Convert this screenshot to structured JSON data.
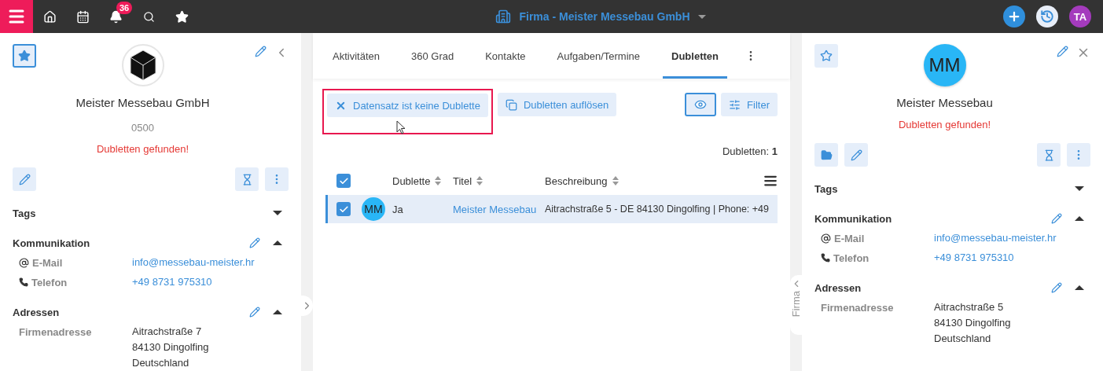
{
  "topbar": {
    "nav": [
      {
        "kind": "home"
      },
      {
        "kind": "calendar"
      },
      {
        "kind": "bell",
        "badge": "36"
      },
      {
        "kind": "search"
      },
      {
        "kind": "star"
      }
    ],
    "title": "Firma - Meister Messebau GmbH",
    "user": "TA"
  },
  "left_panel": {
    "favorite": true,
    "header_action": {
      "kind": "collapse"
    },
    "avatar": {
      "kind": "logo"
    },
    "name": "Meister Messebau GmbH",
    "number": "0500",
    "warning": "Dubletten gefunden!",
    "tools_left": [
      {
        "kind": "edit"
      }
    ],
    "tools_right": [
      {
        "kind": "hourglass"
      },
      {
        "kind": "more"
      }
    ],
    "sections": [
      {
        "title": "Tags",
        "expanded": false,
        "editable": false
      },
      {
        "title": "Kommunikation",
        "expanded": true,
        "editable": true,
        "rows": [
          {
            "kind": "email",
            "label": "E-Mail",
            "lines": [
              "info@messebau-meister.hr"
            ]
          },
          {
            "kind": "phone",
            "label": "Telefon",
            "lines": [
              "+49 8731 975310"
            ]
          }
        ]
      },
      {
        "title": "Adressen",
        "expanded": true,
        "editable": true,
        "rows": [
          {
            "kind": "address",
            "label": "Firmenadresse",
            "lines": [
              "Aitrachstraße 7",
              "84130 Dingolfing",
              "Deutschland"
            ]
          }
        ]
      }
    ]
  },
  "center": {
    "tabs": [
      {
        "label": "Aktivitäten",
        "selected": false
      },
      {
        "label": "360 Grad",
        "selected": false
      },
      {
        "label": "Kontakte",
        "selected": false
      },
      {
        "label": "Aufgaben/Termine",
        "selected": false
      },
      {
        "label": "Dubletten",
        "selected": true
      }
    ],
    "actions": [
      {
        "kind": "dismiss",
        "label": "Datensatz ist keine Dublette",
        "highlighted": true
      },
      {
        "kind": "resolve",
        "label": "Dubletten auflösen",
        "highlighted": false
      }
    ],
    "view_toggle": {
      "selected": true
    },
    "filter": "Filter",
    "count": "Dubletten: **1**",
    "table": {
      "all_checked": true,
      "columns": [
        {
          "label": "Dublette",
          "sortable": true
        },
        {
          "label": "Titel",
          "sortable": true
        },
        {
          "label": "Beschreibung",
          "sortable": true
        }
      ],
      "rows": [
        {
          "checked": true,
          "selected": true,
          "avatar": "MM",
          "dublette": "Ja",
          "titel": "Meister Messebau",
          "beschreibung": "Aitrachstraße 5 - DE 84130 Dingolfing | Phone: +49"
        }
      ]
    }
  },
  "side_tab": "Firma",
  "right_panel": {
    "favorite": false,
    "header_action": {
      "kind": "close"
    },
    "avatar": {
      "kind": "initials",
      "text": "MM"
    },
    "name": "Meister Messebau",
    "warning": "Dubletten gefunden!",
    "tools_left": [
      {
        "kind": "folder"
      },
      {
        "kind": "edit"
      }
    ],
    "tools_right": [
      {
        "kind": "hourglass"
      },
      {
        "kind": "more"
      }
    ],
    "sections": [
      {
        "title": "Tags",
        "expanded": false,
        "editable": false
      },
      {
        "title": "Kommunikation",
        "expanded": true,
        "editable": true,
        "rows": [
          {
            "kind": "email",
            "label": "E-Mail",
            "lines": [
              "info@messebau-meister.hr"
            ]
          },
          {
            "kind": "phone",
            "label": "Telefon",
            "lines": [
              "+49 8731 975310"
            ]
          }
        ]
      },
      {
        "title": "Adressen",
        "expanded": true,
        "editable": true,
        "rows": [
          {
            "kind": "address",
            "label": "Firmenadresse",
            "lines": [
              "Aitrachstraße 5",
              "84130 Dingolfing",
              "Deutschland"
            ]
          }
        ]
      }
    ]
  }
}
